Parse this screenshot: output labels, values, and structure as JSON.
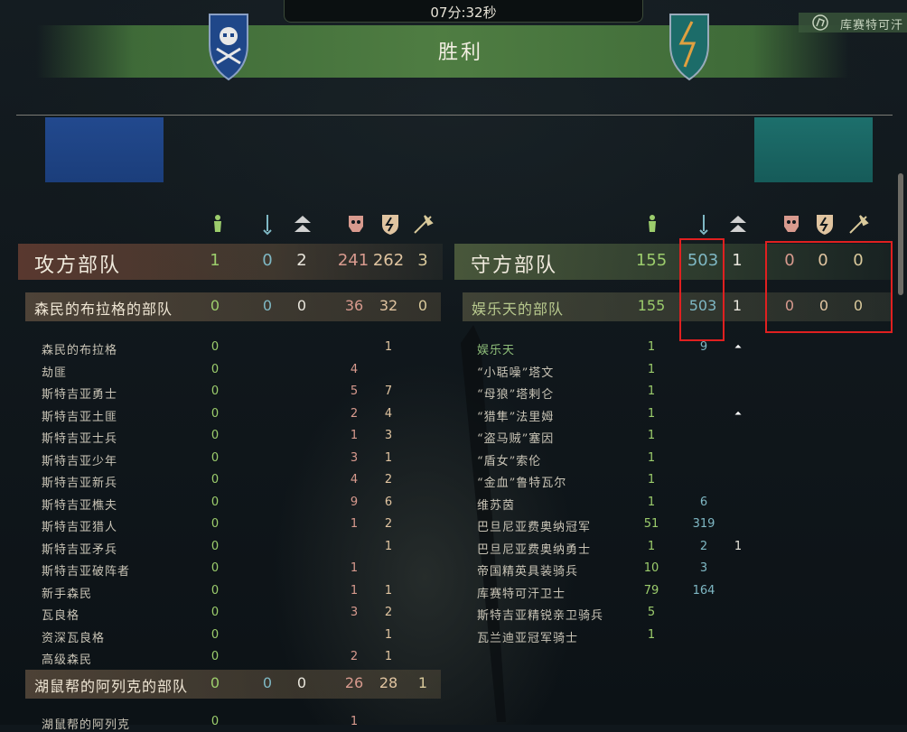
{
  "header": {
    "timer": "07分:32秒",
    "result": "胜利",
    "top_right_tag": "库赛特可汗"
  },
  "colors": {
    "attacker_flag": "#22498e",
    "defender_flag": "#1d6f6c",
    "highlight": "#e02020",
    "banner": "#52823f"
  },
  "icons": [
    "ready-soldier-icon",
    "wounded-icon",
    "upgrade-icon",
    "killed-icon",
    "routed-icon",
    "kills-icon"
  ],
  "attacker": {
    "title": "攻方部队",
    "stats": [
      "1",
      "0",
      "2",
      "241",
      "262",
      "3"
    ],
    "parties": [
      {
        "name": "森民的布拉格的部队",
        "stats": [
          "0",
          "0",
          "0",
          "36",
          "32",
          "0"
        ],
        "troops": [
          {
            "name": "森民的布拉格",
            "ready": "0",
            "killed": "",
            "routed": "1"
          },
          {
            "name": "劫匪",
            "ready": "0",
            "killed": "4",
            "routed": ""
          },
          {
            "name": "斯特吉亚勇士",
            "ready": "0",
            "killed": "5",
            "routed": "7"
          },
          {
            "name": "斯特吉亚土匪",
            "ready": "0",
            "killed": "2",
            "routed": "4"
          },
          {
            "name": "斯特吉亚士兵",
            "ready": "0",
            "killed": "1",
            "routed": "3"
          },
          {
            "name": "斯特吉亚少年",
            "ready": "0",
            "killed": "3",
            "routed": "1"
          },
          {
            "name": "斯特吉亚新兵",
            "ready": "0",
            "killed": "4",
            "routed": "2"
          },
          {
            "name": "斯特吉亚樵夫",
            "ready": "0",
            "killed": "9",
            "routed": "6"
          },
          {
            "name": "斯特吉亚猎人",
            "ready": "0",
            "killed": "1",
            "routed": "2"
          },
          {
            "name": "斯特吉亚矛兵",
            "ready": "0",
            "killed": "",
            "routed": "1"
          },
          {
            "name": "斯特吉亚破阵者",
            "ready": "0",
            "killed": "1",
            "routed": ""
          },
          {
            "name": "新手森民",
            "ready": "0",
            "killed": "1",
            "routed": "1"
          },
          {
            "name": "瓦良格",
            "ready": "0",
            "killed": "3",
            "routed": "2"
          },
          {
            "name": "资深瓦良格",
            "ready": "0",
            "killed": "",
            "routed": "1"
          },
          {
            "name": "高级森民",
            "ready": "0",
            "killed": "2",
            "routed": "1"
          }
        ]
      },
      {
        "name": "湖鼠帮的阿列克的部队",
        "stats": [
          "0",
          "0",
          "0",
          "26",
          "28",
          "1"
        ],
        "troops": [
          {
            "name": "湖鼠帮的阿列克",
            "ready": "0",
            "killed": "1",
            "routed": ""
          }
        ]
      }
    ]
  },
  "defender": {
    "title": "守方部队",
    "stats": [
      "155",
      "503",
      "1",
      "0",
      "0",
      "0"
    ],
    "parties": [
      {
        "name": "娱乐天的部队",
        "stats": [
          "155",
          "503",
          "1",
          "0",
          "0",
          "0"
        ],
        "troops": [
          {
            "name": "娱乐天",
            "ready": "1",
            "wounded": "9",
            "upgrade": "⏶"
          },
          {
            "name": "“小聒噪”塔文",
            "ready": "1",
            "wounded": "",
            "upgrade": ""
          },
          {
            "name": "“母狼”塔剌仑",
            "ready": "1",
            "wounded": "",
            "upgrade": ""
          },
          {
            "name": "“猎隼”法里姆",
            "ready": "1",
            "wounded": "",
            "upgrade": "⏶"
          },
          {
            "name": "“盗马贼”塞因",
            "ready": "1",
            "wounded": "",
            "upgrade": ""
          },
          {
            "name": "“盾女”索伦",
            "ready": "1",
            "wounded": "",
            "upgrade": ""
          },
          {
            "name": "“金血”鲁特瓦尔",
            "ready": "1",
            "wounded": "",
            "upgrade": ""
          },
          {
            "name": "维苏茵",
            "ready": "1",
            "wounded": "6",
            "upgrade": ""
          },
          {
            "name": "巴旦尼亚费奥纳冠军",
            "ready": "51",
            "wounded": "319",
            "upgrade": ""
          },
          {
            "name": "巴旦尼亚费奥纳勇士",
            "ready": "1",
            "wounded": "2",
            "upgrade": "1"
          },
          {
            "name": "帝国精英具装骑兵",
            "ready": "10",
            "wounded": "3",
            "upgrade": ""
          },
          {
            "name": "库赛特可汗卫士",
            "ready": "79",
            "wounded": "164",
            "upgrade": ""
          },
          {
            "name": "斯特吉亚精锐亲卫骑兵",
            "ready": "5",
            "wounded": "",
            "upgrade": ""
          },
          {
            "name": "瓦兰迪亚冠军骑士",
            "ready": "1",
            "wounded": "",
            "upgrade": ""
          }
        ]
      }
    ]
  }
}
